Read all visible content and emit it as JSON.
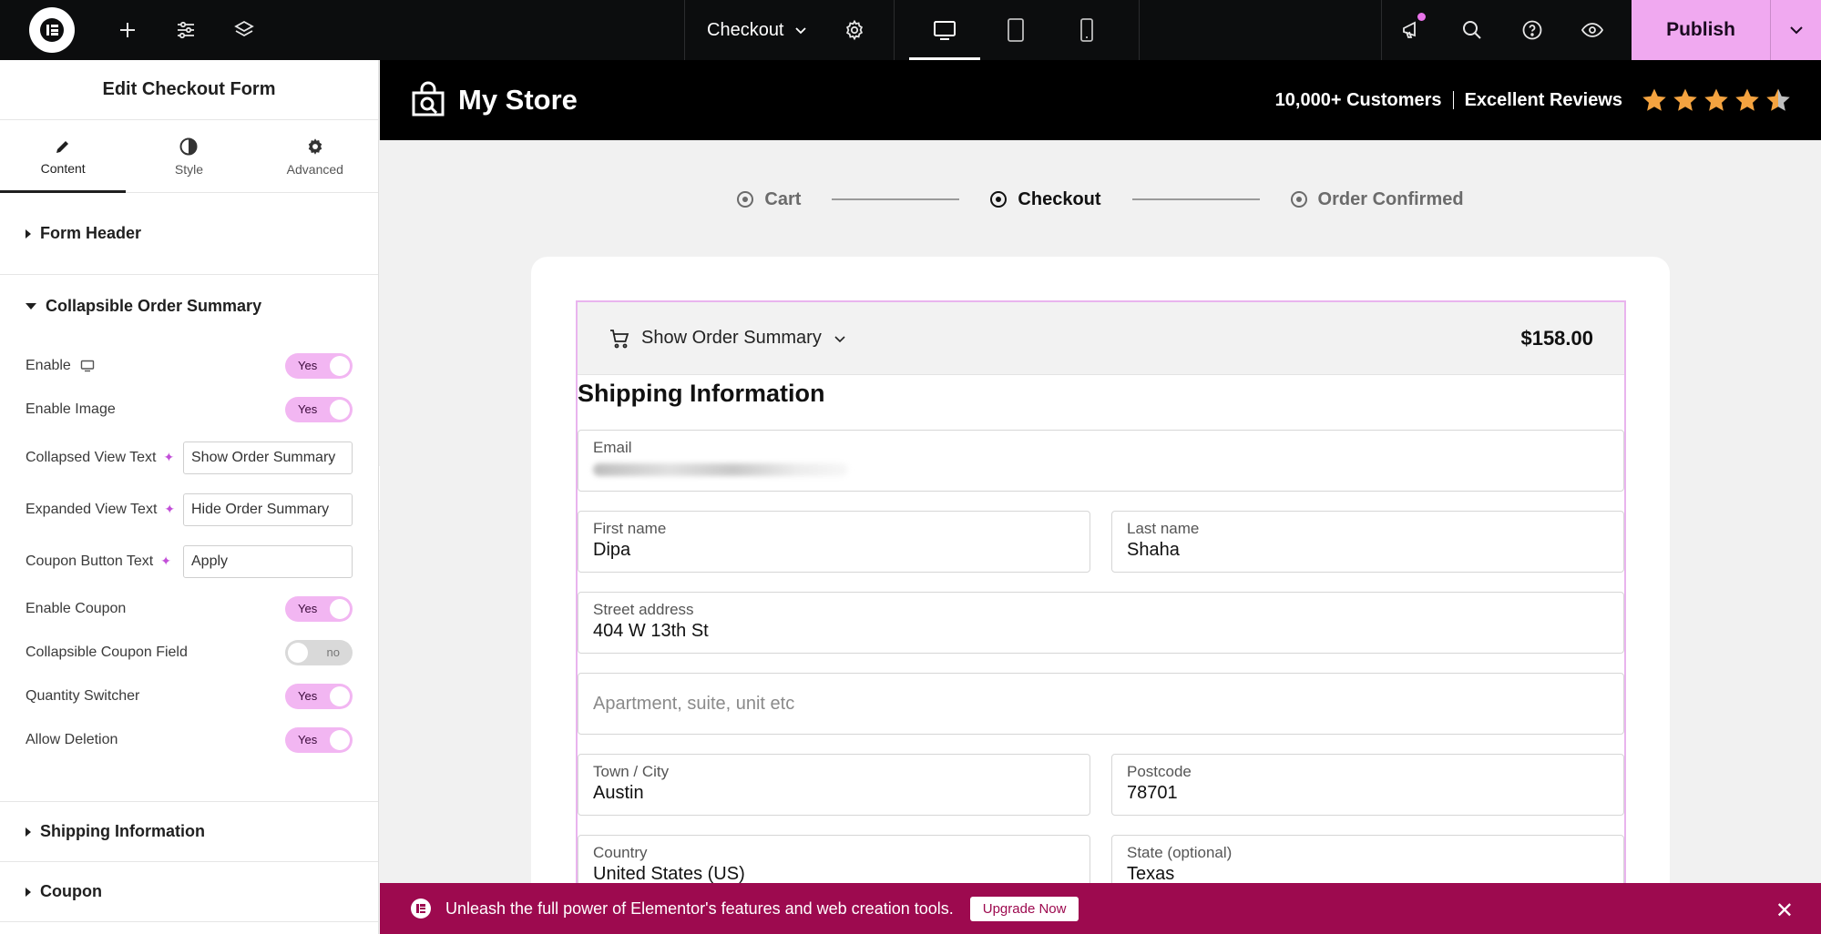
{
  "topbar": {
    "page_name": "Checkout",
    "publish_label": "Publish"
  },
  "panel": {
    "title": "Edit Checkout Form",
    "tabs": [
      {
        "label": "Content",
        "icon": "pencil-icon"
      },
      {
        "label": "Style",
        "icon": "contrast-icon"
      },
      {
        "label": "Advanced",
        "icon": "gear-icon"
      }
    ],
    "sections": {
      "form_header": "Form Header",
      "collapsible_order_summary": "Collapsible Order Summary",
      "shipping_information": "Shipping Information",
      "coupon": "Coupon"
    },
    "controls": {
      "enable": {
        "label": "Enable",
        "value": "Yes"
      },
      "enable_image": {
        "label": "Enable Image",
        "value": "Yes"
      },
      "collapsed_view_text": {
        "label": "Collapsed View Text",
        "value": "Show Order Summary"
      },
      "expanded_view_text": {
        "label": "Expanded View Text",
        "value": "Hide Order Summary"
      },
      "coupon_button_text": {
        "label": "Coupon Button Text",
        "value": "Apply"
      },
      "enable_coupon": {
        "label": "Enable Coupon",
        "value": "Yes"
      },
      "collapsible_coupon_field": {
        "label": "Collapsible Coupon Field",
        "value": "no"
      },
      "quantity_switcher": {
        "label": "Quantity Switcher",
        "value": "Yes"
      },
      "allow_deletion": {
        "label": "Allow Deletion",
        "value": "Yes"
      }
    }
  },
  "store": {
    "brand": "My Store",
    "customers": "10,000+ Customers",
    "reviews": "Excellent Reviews",
    "rating": 4.5
  },
  "steps": [
    "Cart",
    "Checkout",
    "Order Confirmed"
  ],
  "order_summary": {
    "toggle_text": "Show Order Summary",
    "total": "$158.00"
  },
  "shipping": {
    "title": "Shipping Information",
    "email_label": "Email",
    "first_name_label": "First name",
    "first_name": "Dipa",
    "last_name_label": "Last name",
    "last_name": "Shaha",
    "street_label": "Street address",
    "street": "404 W 13th St",
    "apartment_placeholder": "Apartment, suite, unit etc",
    "city_label": "Town / City",
    "city": "Austin",
    "postcode_label": "Postcode",
    "postcode": "78701",
    "country_label": "Country",
    "country": "United States (US)",
    "state_label": "State (optional)",
    "state": "Texas"
  },
  "promo": {
    "text": "Unleash the full power of Elementor's features and web creation tools.",
    "button": "Upgrade Now"
  },
  "colors": {
    "accent_pink": "#f0a9f0",
    "promo_bg": "#9d0a4f",
    "star": "#f4a340"
  }
}
